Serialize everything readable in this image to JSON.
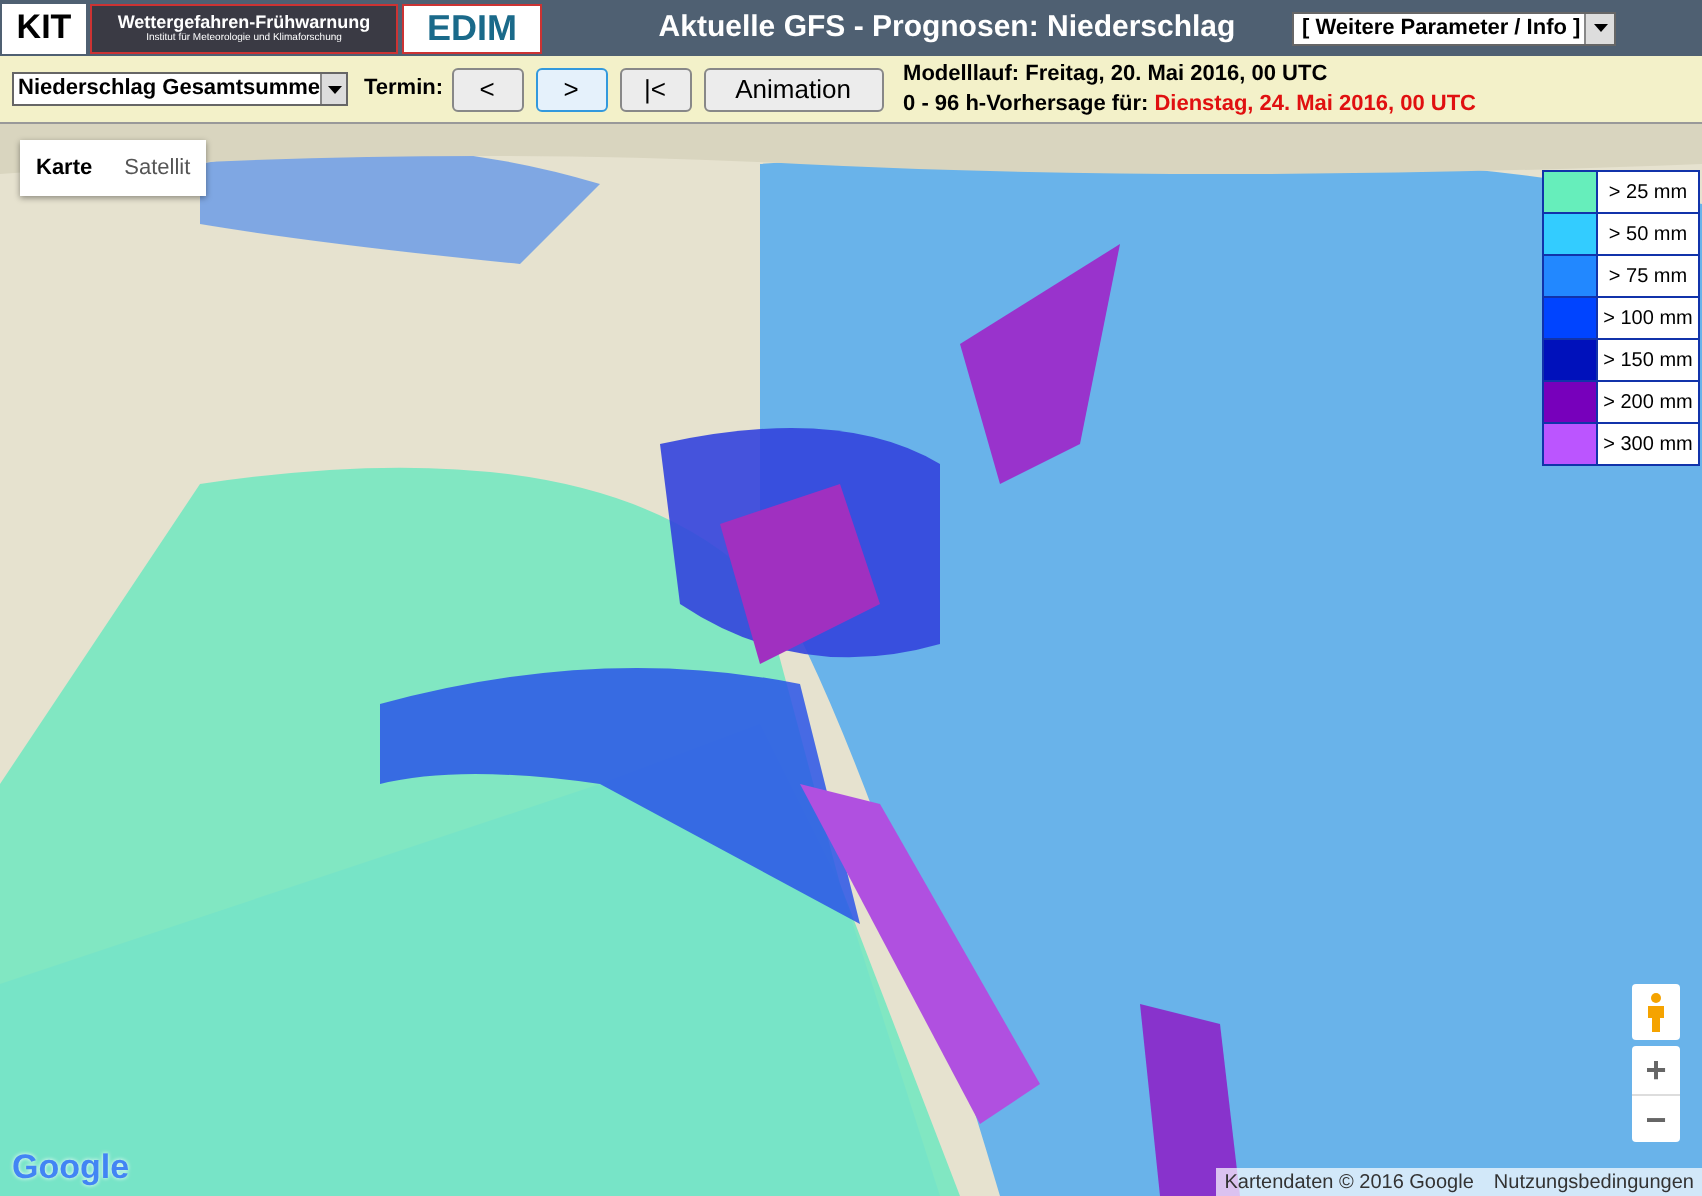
{
  "header": {
    "logos": [
      {
        "kind": "kit",
        "text": "KIT"
      },
      {
        "kind": "banner",
        "text": "Wettergefahren-Frühwarnung",
        "subtext": "Institut für Meteorologie und Klimaforschung"
      },
      {
        "kind": "edim",
        "text": "EDIM"
      }
    ],
    "title": "Aktuelle GFS - Prognosen: Niederschlag",
    "menu": "[ Weitere Parameter / Info ]"
  },
  "toolbar": {
    "parameter": "Niederschlag Gesamtsumme",
    "termin_label": "Termin:",
    "buttons": [
      {
        "label": "<",
        "selected": false
      },
      {
        "label": ">",
        "selected": true
      },
      {
        "label": "|<",
        "selected": false
      },
      {
        "label": "Animation",
        "selected": false
      }
    ],
    "model_run": "Modelllauf: Freitag, 20. Mai 2016, 00 UTC",
    "forecast_label": "0 - 96 h-Vorhersage für:",
    "forecast_date": "Dienstag, 24. Mai 2016, 00 UTC"
  },
  "map": {
    "map_types": [
      {
        "label": "Karte",
        "selected": true
      },
      {
        "label": "Satellit",
        "selected": false
      }
    ],
    "legend": [
      {
        "label": "> 25 mm",
        "color": "#66eebb"
      },
      {
        "label": "> 50 mm",
        "color": "#33ccff"
      },
      {
        "label": "> 75 mm",
        "color": "#2288ff"
      },
      {
        "label": "> 100 mm",
        "color": "#0044ff"
      },
      {
        "label": "> 150 mm",
        "color": "#0011bb"
      },
      {
        "label": "> 200 mm",
        "color": "#7700bb"
      },
      {
        "label": "> 300 mm",
        "color": "#bb55ff"
      }
    ],
    "zoom": [
      "+",
      "−"
    ],
    "logo": "Google",
    "attribution": "Kartendaten © 2016 Google",
    "terms": "Nutzungsbedingungen"
  }
}
